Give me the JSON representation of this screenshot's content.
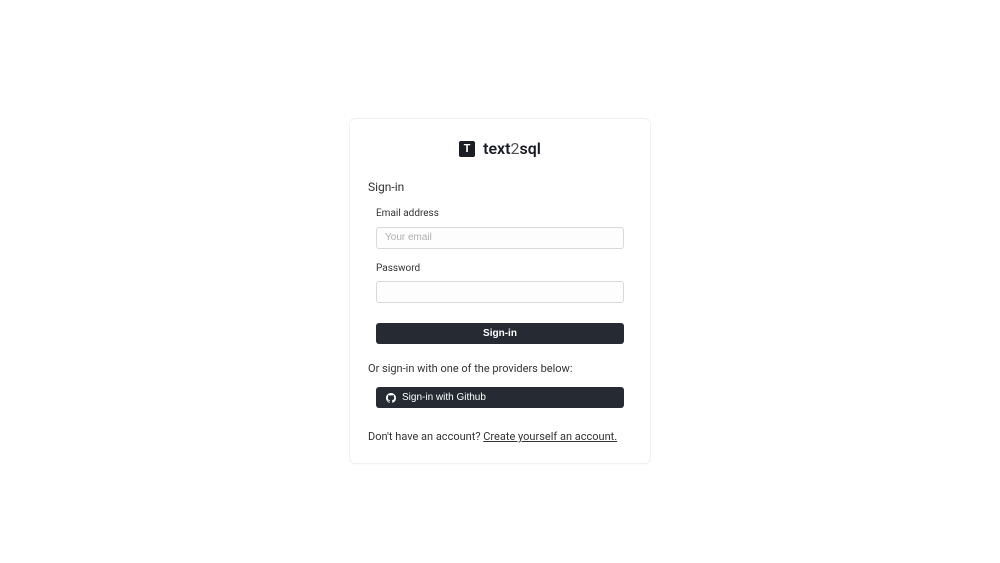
{
  "logo": {
    "badge": "T",
    "part1": "text",
    "part2": "2",
    "part3": "sql"
  },
  "heading": "Sign-in",
  "form": {
    "email_label": "Email address",
    "email_placeholder": "Your email",
    "password_label": "Password",
    "submit_label": "Sign-in"
  },
  "divider_text": "Or sign-in with one of the providers below:",
  "github_button": "Sign-in with Github",
  "footer": {
    "prompt": "Don't have an account? ",
    "link": "Create yourself an account."
  }
}
